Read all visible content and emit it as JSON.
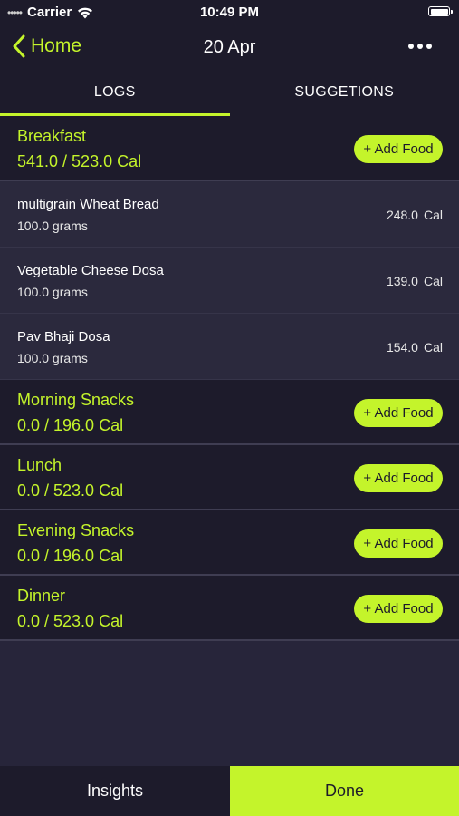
{
  "status_bar": {
    "carrier": "Carrier",
    "signal_dots": "•••••",
    "time": "10:49 PM"
  },
  "nav": {
    "back_label": "Home",
    "title": "20 Apr"
  },
  "tabs": [
    {
      "label": "LOGS",
      "active": true
    },
    {
      "label": "SUGGETIONS",
      "active": false
    }
  ],
  "add_food_label": "+ Add Food",
  "meals": [
    {
      "name": "Breakfast",
      "calories": "541.0 / 523.0 Cal",
      "items": [
        {
          "name": "multigrain Wheat Bread",
          "quantity": "100.0 grams",
          "calories": "248.0",
          "unit": "Cal"
        },
        {
          "name": "Vegetable Cheese Dosa",
          "quantity": "100.0 grams",
          "calories": "139.0",
          "unit": "Cal"
        },
        {
          "name": "Pav Bhaji Dosa",
          "quantity": "100.0 grams",
          "calories": "154.0",
          "unit": "Cal"
        }
      ]
    },
    {
      "name": "Morning Snacks",
      "calories": "0.0 / 196.0 Cal",
      "items": []
    },
    {
      "name": "Lunch",
      "calories": "0.0 / 523.0 Cal",
      "items": []
    },
    {
      "name": "Evening Snacks",
      "calories": "0.0 / 196.0 Cal",
      "items": []
    },
    {
      "name": "Dinner",
      "calories": "0.0 / 523.0 Cal",
      "items": []
    }
  ],
  "bottom": {
    "insights_label": "Insights",
    "done_label": "Done"
  },
  "colors": {
    "accent": "#c4f42b",
    "background": "#27253a",
    "header": "#1d1b2b"
  }
}
